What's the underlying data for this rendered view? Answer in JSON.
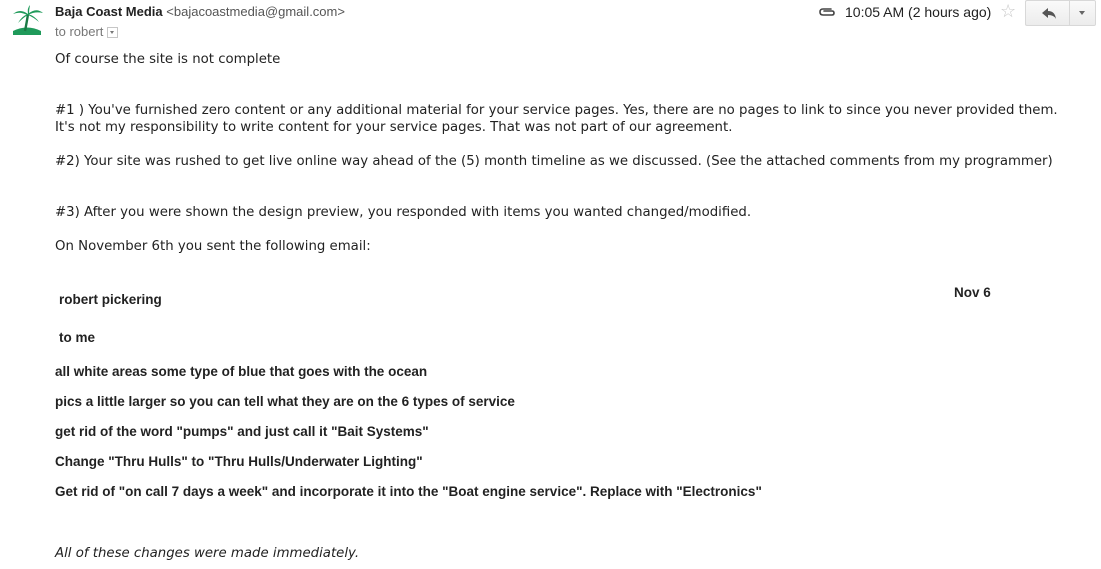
{
  "header": {
    "sender_name": "Baja Coast Media",
    "sender_email": "<bajacoastmedia@gmail.com>",
    "recipient": "to robert",
    "timestamp": "10:05 AM (2 hours ago)",
    "icons": {
      "avatar": "palm-tree-island-icon",
      "attachment": "paperclip-icon",
      "star": "star-outline-icon",
      "reply": "reply-arrow-icon",
      "more": "chevron-down-icon"
    }
  },
  "body": {
    "intro": "Of course the site is not complete",
    "point1": "#1 )  You've furnished zero content or any additional material for your service pages.   Yes, there are no pages to link to since you never provided them.   It's not my responsibility to write content for your service pages.  That was not part of our agreement.",
    "point2": "#2)  Your site was rushed to get live online way ahead of the (5) month timeline as we discussed.  (See the attached comments from my programmer)",
    "point3": "#3)  After you were shown the design preview, you responded with items you wanted changed/modified.",
    "lead_in": "On November 6th you sent the following email:",
    "closing": "All of these changes were made immediately."
  },
  "quoted_email": {
    "sender": "robert pickering",
    "date": "Nov 6",
    "recipient": "to me",
    "lines": [
      "all white areas some type of blue that goes with the ocean",
      "pics a little larger so you can tell what they are on the 6 types of service",
      "get rid of the word \"pumps\" and just call it \"Bait Systems\"",
      "Change \"Thru Hulls\" to \"Thru Hulls/Underwater Lighting\"",
      "Get rid of \"on call 7 days a week\" and incorporate it into the \"Boat engine service\".  Replace with \"Electronics\""
    ]
  },
  "colors": {
    "text": "#222222",
    "muted": "#777777",
    "star": "#c8c8c8",
    "palm_green": "#1f9a5a"
  }
}
